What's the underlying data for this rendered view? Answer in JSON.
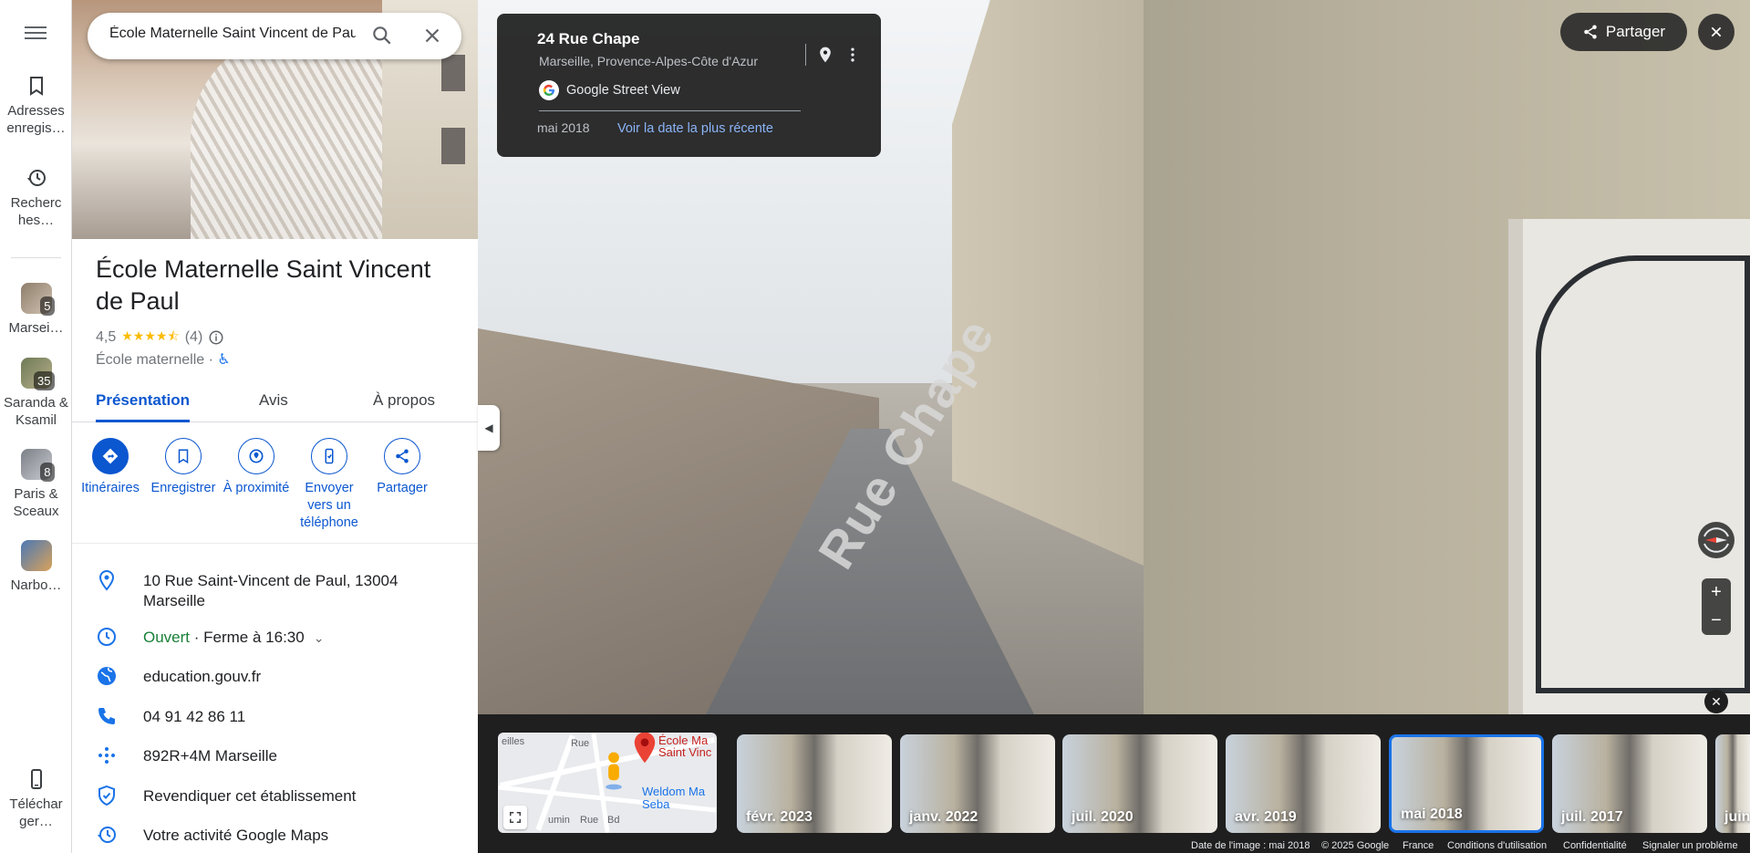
{
  "rail": {
    "saved_label": "Adresses enregis…",
    "history_label": "Recherc hes…",
    "lists": [
      {
        "label": "Marsei…",
        "count": "5"
      },
      {
        "label": "Saranda & Ksamil",
        "count": "35"
      },
      {
        "label": "Paris & Sceaux",
        "count": "8"
      },
      {
        "label": "Narbo…",
        "count": ""
      }
    ],
    "download_label": "Téléchar ger…"
  },
  "search": {
    "value": "École Maternelle Saint Vincent de Paul"
  },
  "place": {
    "title": "École Maternelle Saint Vincent de Paul",
    "rating": "4,5",
    "stars": "★★★★⯪",
    "review_count": "(4)",
    "category": "École maternelle",
    "separator": "·",
    "accessibility_icon": "♿"
  },
  "tabs": [
    {
      "label": "Présentation",
      "active": true
    },
    {
      "label": "Avis",
      "active": false
    },
    {
      "label": "À propos",
      "active": false
    }
  ],
  "actions": [
    {
      "label": "Itinéraires",
      "icon": "directions-icon"
    },
    {
      "label": "Enregistrer",
      "icon": "bookmark-icon"
    },
    {
      "label": "À proximité",
      "icon": "nearby-icon"
    },
    {
      "label": "Envoyer vers un téléphone",
      "icon": "send-to-phone-icon"
    },
    {
      "label": "Partager",
      "icon": "share-icon"
    }
  ],
  "info": {
    "address": "10 Rue Saint-Vincent de Paul, 13004 Marseille",
    "hours_status": "Ouvert",
    "hours_detail": " · Ferme à 16:30",
    "website": "education.gouv.fr",
    "phone": "04 91 42 86 11",
    "plus_code": "892R+4M Marseille",
    "claim": "Revendiquer cet établissement",
    "activity": "Votre activité Google Maps"
  },
  "streetview": {
    "street": "24 Rue Chape",
    "region": "Marseille, Provence-Alpes-Côte d'Azur",
    "source": "Google Street View",
    "date": "mai 2018",
    "recent_link": "Voir la date la plus récente",
    "road_label": "Rue Chape",
    "share_label": "Partager"
  },
  "minimap": {
    "poi_name": "École Ma Saint Vinc",
    "poi2_name": "Weldom Ma Seba",
    "streets": [
      "eilles",
      "Rue",
      "Rue",
      "Bd",
      "umin"
    ]
  },
  "timeline": [
    {
      "label": "févr. 2023",
      "selected": false
    },
    {
      "label": "janv. 2022",
      "selected": false
    },
    {
      "label": "juil. 2020",
      "selected": false
    },
    {
      "label": "avr. 2019",
      "selected": false
    },
    {
      "label": "mai 2018",
      "selected": true
    },
    {
      "label": "juil. 2017",
      "selected": false
    },
    {
      "label": "juin",
      "selected": false
    }
  ],
  "footer": {
    "image_date": "Date de l'image : mai 2018",
    "copyright": "© 2025 Google",
    "country": "France",
    "terms": "Conditions d'utilisation",
    "privacy": "Confidentialité",
    "report": "Signaler un problème"
  },
  "colors": {
    "accent": "#0b57d0",
    "open": "#188038",
    "link_dark": "#8ab4f8",
    "star": "#fbbc04"
  }
}
